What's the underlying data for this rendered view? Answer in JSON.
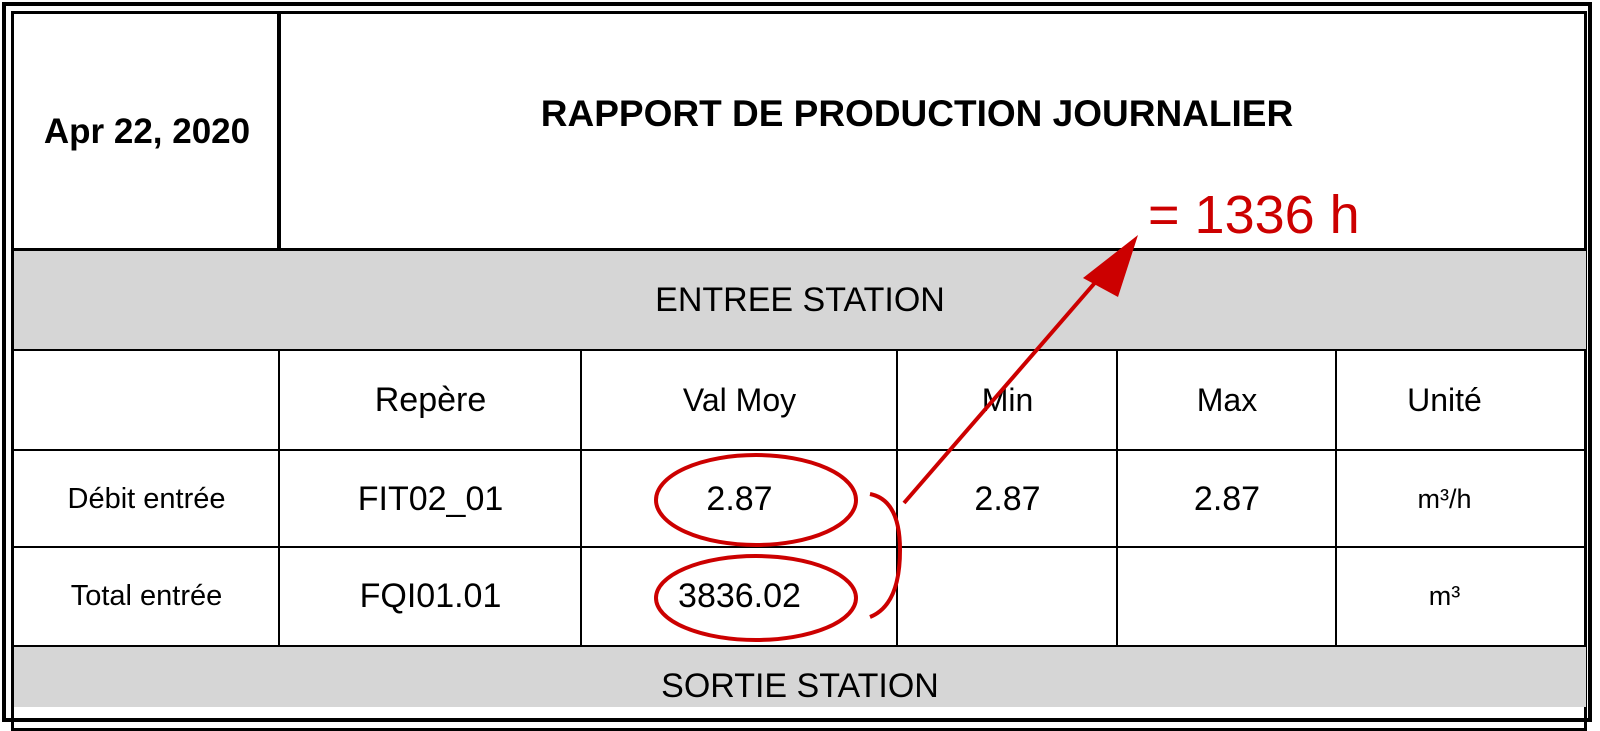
{
  "report": {
    "date": "Apr 22, 2020",
    "title": "RAPPORT DE PRODUCTION JOURNALIER"
  },
  "entree_section": {
    "label": "ENTREE STATION",
    "columns": [
      "",
      "Repère",
      "Val Moy",
      "Min",
      "Max",
      "Unité"
    ],
    "rows": [
      {
        "label": "Débit entrée",
        "repere": "FIT02_01",
        "val_moy": "2.87",
        "min": "2.87",
        "max": "2.87",
        "unite": "m³/h"
      },
      {
        "label": "Total entrée",
        "repere": "FQI01.01",
        "val_moy": "3836.02",
        "min": "",
        "max": "",
        "unite": "m³"
      }
    ]
  },
  "sortie_section": {
    "label": "SORTIE STATION"
  },
  "annotation": {
    "result_text": "= 1336 h",
    "color": "#cc0000"
  }
}
